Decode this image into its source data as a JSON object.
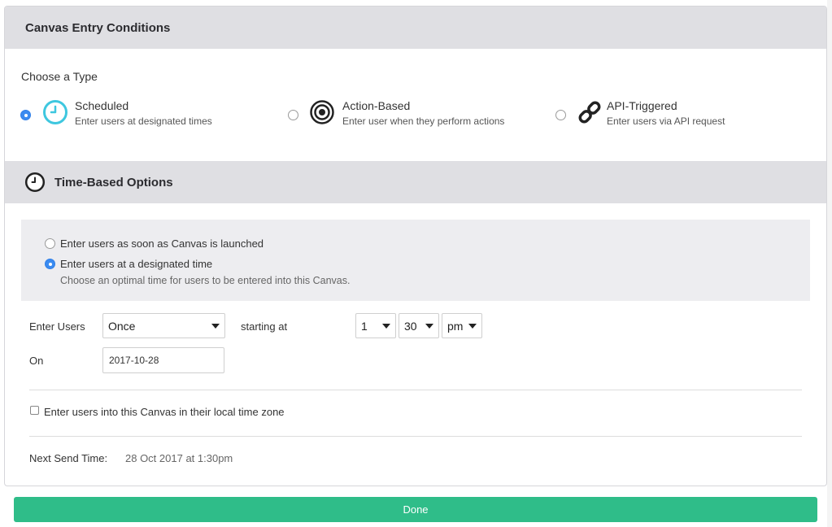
{
  "entry_conditions": {
    "header": "Canvas Entry Conditions",
    "choose_label": "Choose a Type",
    "types": [
      {
        "title": "Scheduled",
        "description": "Enter users at designated times",
        "icon": "clock-icon",
        "selected": true
      },
      {
        "title": "Action-Based",
        "description": "Enter user when they perform actions",
        "icon": "target-icon",
        "selected": false
      },
      {
        "title": "API-Triggered",
        "description": "Enter users via API request",
        "icon": "link-icon",
        "selected": false
      }
    ]
  },
  "time_options": {
    "header": "Time-Based Options",
    "option_launch": "Enter users as soon as Canvas is launched",
    "option_designated": "Enter users at a designated time",
    "designated_hint": "Choose an optimal time for users to be entered into this Canvas.",
    "selected_option": "Enter users at a designated time",
    "enter_users_label": "Enter Users",
    "frequency_value": "Once",
    "starting_at_label": "starting at",
    "hour_value": "1",
    "minute_value": "30",
    "ampm_value": "pm",
    "on_label": "On",
    "date_value": "2017-10-28",
    "local_tz_label": "Enter users into this Canvas in their local time zone",
    "local_tz_checked": false,
    "next_send_label": "Next Send Time:",
    "next_send_value": "28 Oct 2017 at 1:30pm"
  },
  "footer": {
    "done_label": "Done"
  },
  "colors": {
    "accent_green": "#2fbd89",
    "radio_blue": "#3b8bf0",
    "clock_teal": "#3ec7df",
    "header_bg": "#dfdfe3"
  }
}
